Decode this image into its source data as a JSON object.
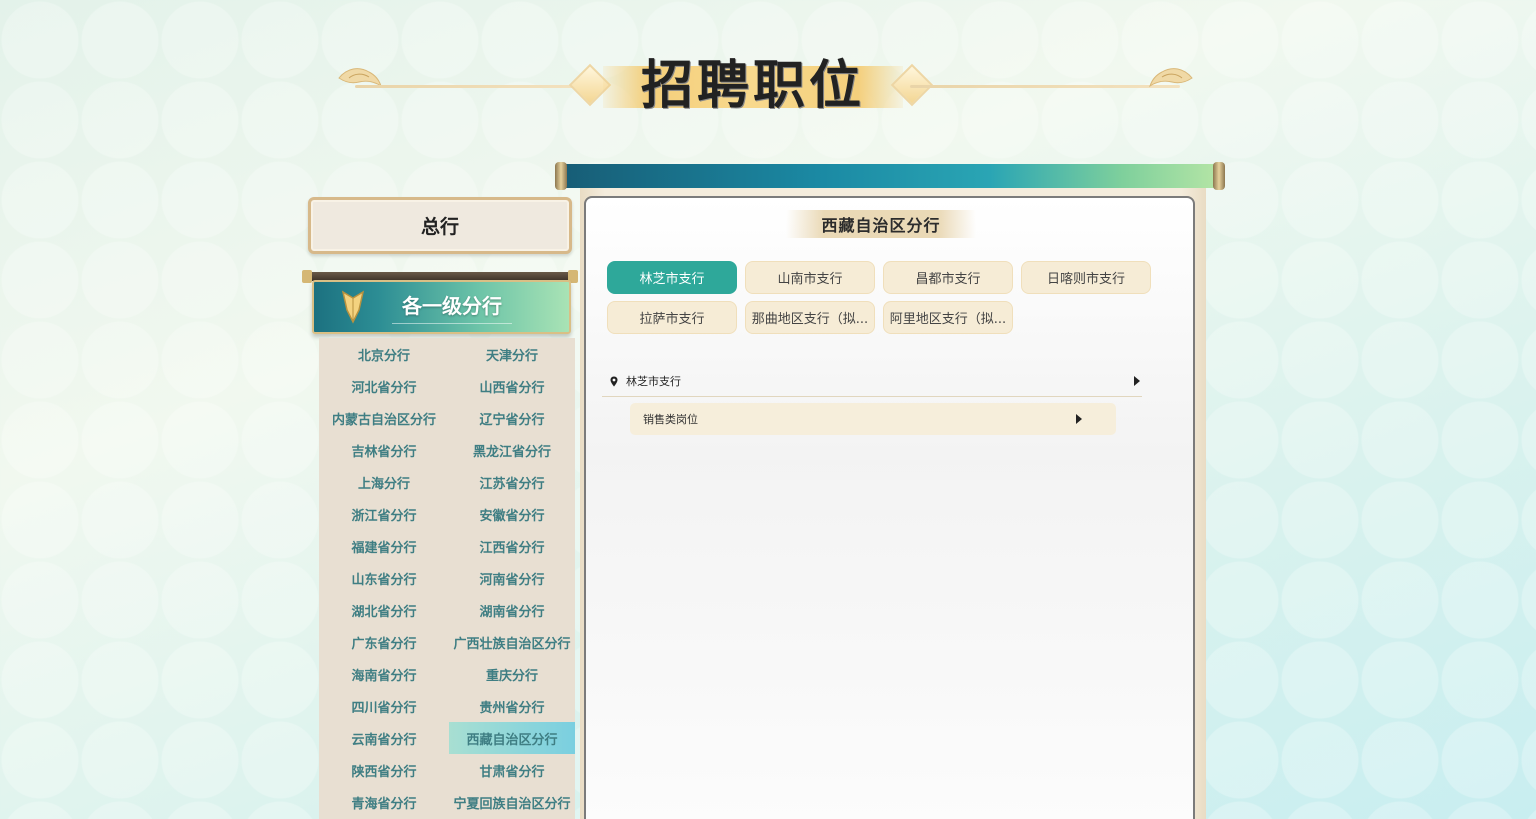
{
  "header": {
    "title": "招聘职位"
  },
  "sidebar": {
    "headquarters_label": "总行",
    "tier_label": "各一级分行",
    "branches": [
      "北京分行",
      "天津分行",
      "河北省分行",
      "山西省分行",
      "内蒙古自治区分行",
      "辽宁省分行",
      "吉林省分行",
      "黑龙江省分行",
      "上海分行",
      "江苏省分行",
      "浙江省分行",
      "安徽省分行",
      "福建省分行",
      "江西省分行",
      "山东省分行",
      "河南省分行",
      "湖北省分行",
      "湖南省分行",
      "广东省分行",
      "广西壮族自治区分行",
      "海南省分行",
      "重庆分行",
      "四川省分行",
      "贵州省分行",
      "云南省分行",
      "西藏自治区分行",
      "陕西省分行",
      "甘肃省分行",
      "青海省分行",
      "宁夏回族自治区分行"
    ],
    "active_branch": "西藏自治区分行"
  },
  "panel": {
    "region_title": "西藏自治区分行",
    "sub_branches": [
      "林芝市支行",
      "山南市支行",
      "昌都市支行",
      "日喀则市支行",
      "拉萨市支行",
      "那曲地区支行（拟...",
      "阿里地区支行（拟..."
    ],
    "active_sub_branch": "林芝市支行",
    "location": {
      "name": "林芝市支行"
    },
    "jobs": [
      {
        "name": "销售类岗位"
      }
    ]
  },
  "colors": {
    "accent_teal": "#2ea89a",
    "branch_text": "#3f7e83",
    "tab_bg": "#f6ecd6",
    "gold_border": "#d7b98a"
  },
  "icons": {
    "location": "map-pin-icon",
    "expand": "caret-right-icon",
    "tier": "chevron-down-icon"
  }
}
